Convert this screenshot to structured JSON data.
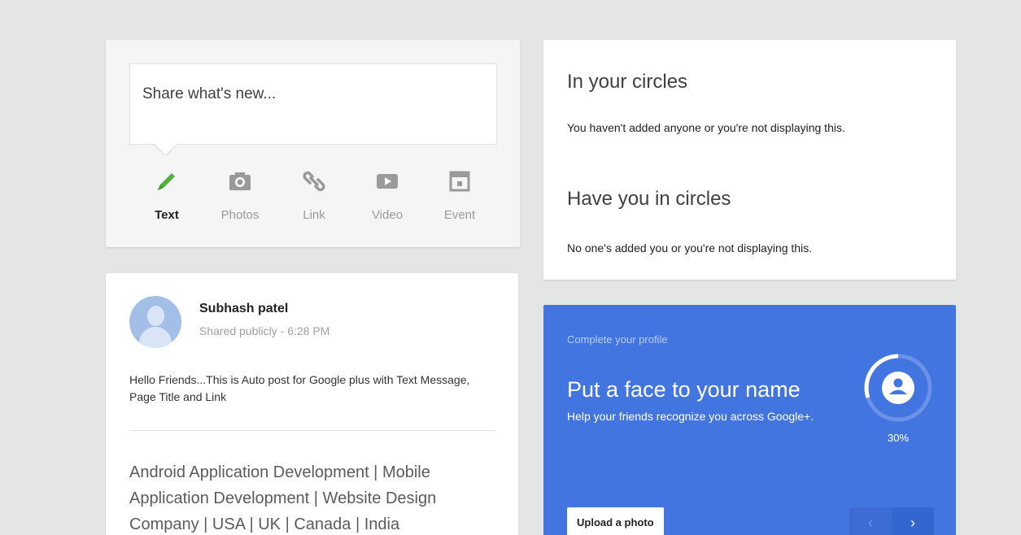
{
  "share": {
    "placeholder": "Share what's new...",
    "options": [
      {
        "label": "Text",
        "icon": "pencil-icon",
        "active": true
      },
      {
        "label": "Photos",
        "icon": "camera-icon",
        "active": false
      },
      {
        "label": "Link",
        "icon": "link-icon",
        "active": false
      },
      {
        "label": "Video",
        "icon": "video-icon",
        "active": false
      },
      {
        "label": "Event",
        "icon": "calendar-icon",
        "active": false
      }
    ]
  },
  "post": {
    "author": "Subhash patel",
    "visibility": "Shared publicly",
    "separator": "-",
    "time": "6:28 PM",
    "text": "Hello Friends...This is Auto post for Google plus with Text Message, Page Title and Link",
    "link_title": "Android Application Development | Mobile Application Development | Website Design Company | USA | UK | Canada | India"
  },
  "circles": {
    "in_title": "In your circles",
    "in_text": "You haven't added anyone or you're not displaying this.",
    "have_title": "Have you in circles",
    "have_text": "No one's added you or you're not displaying this."
  },
  "profile": {
    "subtitle": "Complete your profile",
    "title": "Put a face to your name",
    "text": "Help your friends recognize you across Google+.",
    "progress_label": "30%",
    "progress": 0.3,
    "upload_label": "Upload a photo",
    "prev_label": "‹",
    "next_label": "›"
  },
  "colors": {
    "background": "#e5e5e5",
    "accent_green": "#4db33d",
    "profile_blue": "#4375e0"
  }
}
